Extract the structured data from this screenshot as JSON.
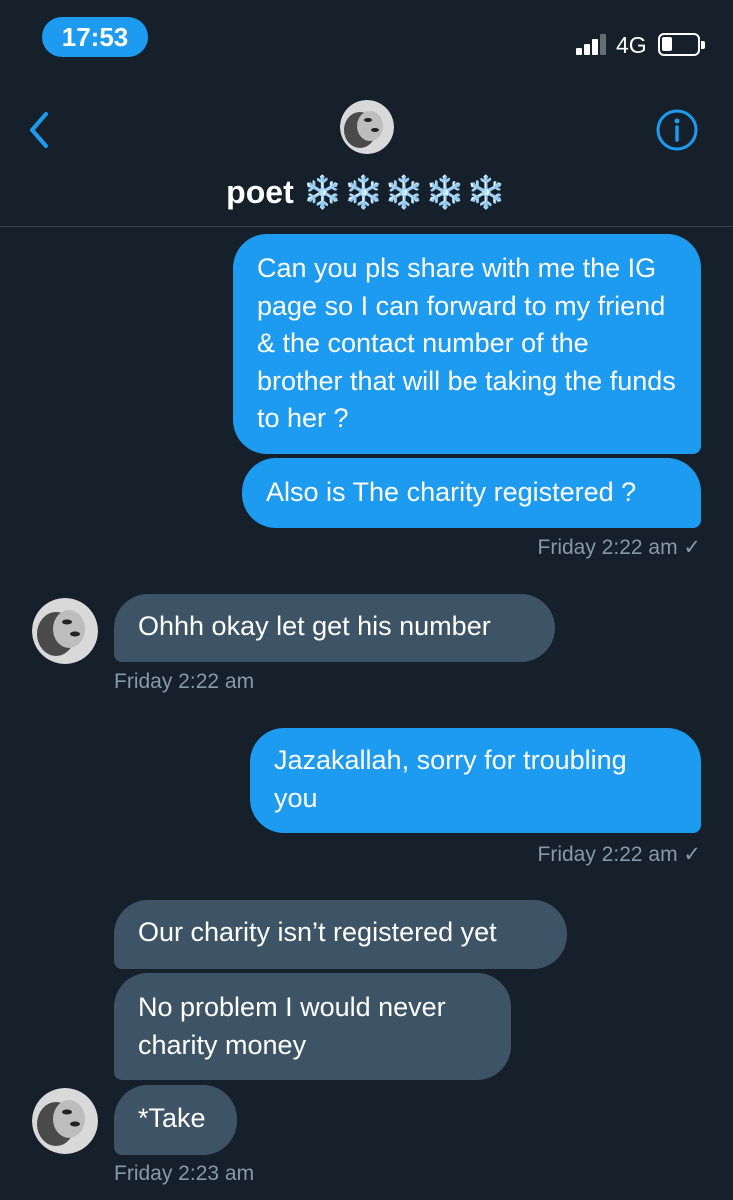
{
  "status_bar": {
    "time": "17:53",
    "network": "4G"
  },
  "header": {
    "back_icon": "chevron-left-icon",
    "contact_name": "poet",
    "name_decoration": "❄️❄️❄️❄️❄️",
    "info_icon": "info-circle-icon"
  },
  "colors": {
    "background": "#15202b",
    "sent_bubble": "#1d9bf0",
    "received_bubble": "#3d5466",
    "timestamp": "#8899a6"
  },
  "messages": [
    {
      "direction": "sent",
      "text": "Can you pls share with me the IG page so I can forward to my friend & the contact number of the brother that will be taking the funds to her ?"
    },
    {
      "direction": "sent",
      "text": "Also is The charity registered ?"
    },
    {
      "direction": "sent",
      "timestamp": "Friday 2:22 am ✓"
    },
    {
      "direction": "received",
      "text": "Ohhh okay let get his number"
    },
    {
      "direction": "received",
      "timestamp": "Friday 2:22 am"
    },
    {
      "direction": "sent",
      "text": "Jazakallah, sorry for troubling you"
    },
    {
      "direction": "sent",
      "timestamp": "Friday 2:22 am ✓"
    },
    {
      "direction": "received",
      "text": "Our charity isn’t registered yet"
    },
    {
      "direction": "received",
      "text": "No problem I would never charity money"
    },
    {
      "direction": "received",
      "text": "*Take"
    },
    {
      "direction": "received",
      "timestamp": "Friday 2:23 am"
    }
  ]
}
